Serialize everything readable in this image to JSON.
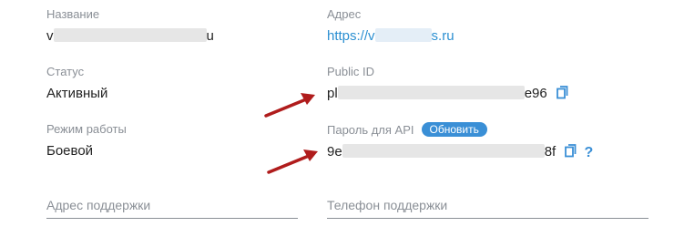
{
  "fields": {
    "name": {
      "label": "Название",
      "prefix": "v",
      "suffix": "u"
    },
    "address": {
      "label": "Адрес",
      "prefix": "https://v",
      "suffix": "s.ru"
    },
    "status": {
      "label": "Статус",
      "value": "Активный"
    },
    "public_id": {
      "label": "Public ID",
      "prefix": "pl",
      "suffix": "e96"
    },
    "mode": {
      "label": "Режим работы",
      "value": "Боевой"
    },
    "api_password": {
      "label": "Пароль для API",
      "prefix": "9e",
      "suffix": "8f",
      "refresh_label": "Обновить"
    }
  },
  "inputs": {
    "support_address": {
      "placeholder": "Адрес поддержки"
    },
    "support_phone": {
      "placeholder": "Телефон поддержки"
    }
  },
  "colors": {
    "accent": "#3a8fd6",
    "link": "#2b8fd1",
    "arrow": "#b01c1c",
    "label": "#8a8f96"
  },
  "icons": {
    "copy": "copy-icon",
    "help": "question-icon",
    "arrow": "red-arrow-annotation"
  }
}
